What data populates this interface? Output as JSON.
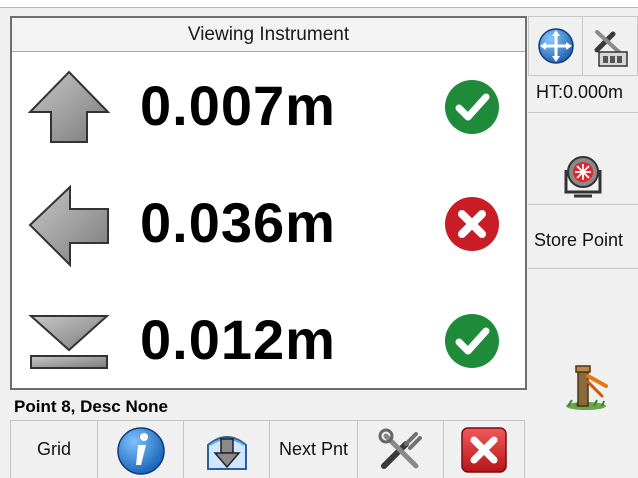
{
  "panel": {
    "title": "Viewing Instrument"
  },
  "offsets": [
    {
      "direction": "up-arrow",
      "value": "0.007m",
      "status": "ok"
    },
    {
      "direction": "left-arrow",
      "value": "0.036m",
      "status": "error"
    },
    {
      "direction": "cut-fill-triangle",
      "value": "0.012m",
      "status": "ok"
    }
  ],
  "point": {
    "description": "Point 8, Desc None"
  },
  "toolbar": {
    "grid_label": "Grid",
    "info_icon": "info-icon",
    "download_icon": "store-down-arrow-icon",
    "next_label": "Next Pnt",
    "tools_icon": "tools-icon",
    "close_icon": "close-icon"
  },
  "sidebar": {
    "ht_label": "HT:0.000m",
    "store_label": "Store Point"
  },
  "colors": {
    "ok": "#1f8a3a",
    "error": "#c81d25",
    "accent": "#1a6fc4"
  }
}
